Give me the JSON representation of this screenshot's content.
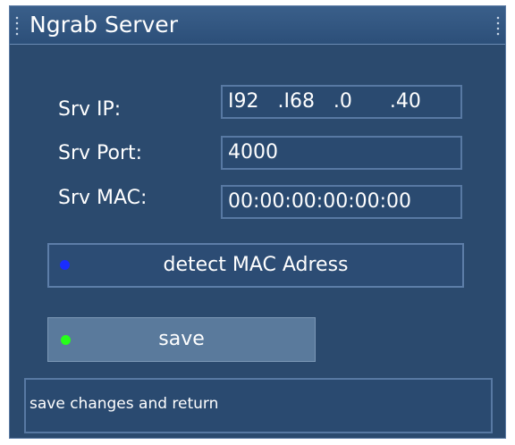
{
  "window": {
    "title": "Ngrab Server"
  },
  "fields": [
    {
      "label": "Srv IP:",
      "value": "I92   .I68   .0      .40"
    },
    {
      "label": "Srv Port:",
      "value": "4000"
    },
    {
      "label": "Srv MAC:",
      "value": "00:00:00:00:00:00"
    }
  ],
  "buttons": {
    "detect_label": "detect MAC Adress",
    "save_label": "save"
  },
  "colors": {
    "blue_key": "#1a2dff",
    "green_key": "#27ff1a",
    "background": "#2b4a6e"
  },
  "status": {
    "text": "save changes and return"
  }
}
